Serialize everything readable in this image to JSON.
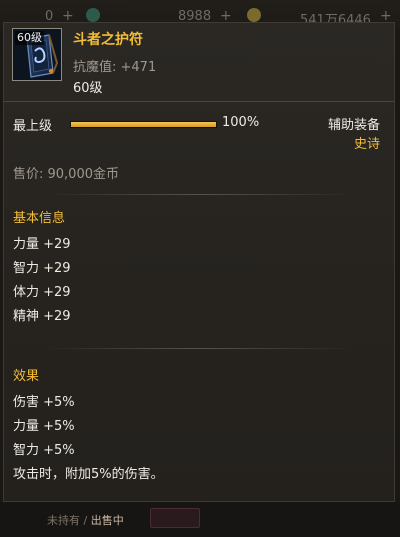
{
  "hud": {
    "items": [
      {
        "value": "0",
        "plus": "+"
      },
      {
        "value": "8988",
        "plus": "+"
      },
      {
        "value": "541万6446",
        "plus": "+"
      }
    ],
    "status_prefix": "未持有",
    "status_sep": " / ",
    "status_highlight": "出售中"
  },
  "item": {
    "level_badge": "60级",
    "name": "斗者之护符",
    "stat": "抗魔值: +471",
    "required_level": "60级",
    "max_label": "最上级",
    "progress_percent": 100,
    "progress_text": "100%",
    "type": "辅助装备",
    "rarity": "史诗",
    "price": "售价: 90,000金币"
  },
  "basic": {
    "title": "基本信息",
    "rows": [
      "力量 +29",
      "智力 +29",
      "体力 +29",
      "精神 +29"
    ]
  },
  "effects": {
    "title": "效果",
    "rows": [
      "伤害 +5%",
      "力量 +5%",
      "智力 +5%",
      "攻击时，附加5%的伤害。"
    ]
  },
  "colors": {
    "title_gold": "#f2bd36",
    "muted": "#9d978e",
    "text": "#eeeae4"
  }
}
